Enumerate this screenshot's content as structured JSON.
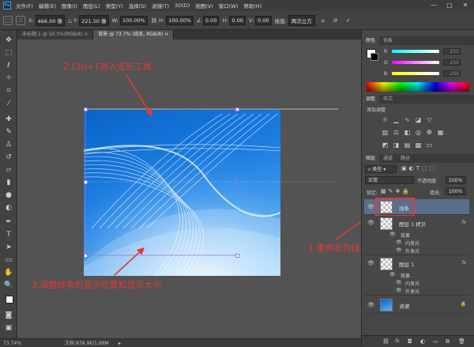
{
  "menubar": {
    "logo": "Ps",
    "items": [
      "文件(F)",
      "编辑(E)",
      "图像(I)",
      "图层(L)",
      "类型(Y)",
      "选择(S)",
      "滤镜(T)",
      "3D(D)",
      "视图(V)",
      "窗口(W)",
      "帮助(H)"
    ],
    "window_buttons": [
      "—",
      "□",
      "✕"
    ]
  },
  "options": {
    "x_label": "X:",
    "x_value": "466.00 像",
    "y_label": "Y:",
    "y_value": "221.50 像",
    "w_label": "W:",
    "w_value": "100.00%",
    "h_label": "H:",
    "h_value": "100.00%",
    "angle_value": "0.00",
    "hskew_label": "H:",
    "hskew_value": "0.00",
    "vskew_label": "V:",
    "vskew_value": "0.00",
    "interp_label": "插值:",
    "interp_value": "两次立方"
  },
  "tabs": [
    {
      "label": "未标题-1 @ 50.5%(RGB/8)",
      "close": "×"
    },
    {
      "label": "背景 @ 73.7% (线条, RGB/8)",
      "close": "×"
    }
  ],
  "status": {
    "zoom": "73.74%",
    "doc": "文档:878.9K/1.88M"
  },
  "annotations": {
    "a1": "2.Ctrl+T进入变形工具",
    "a2": "1.重命名为线条",
    "a3": "3.调整线条的显示位置和显示大小"
  },
  "color_panel": {
    "tab_color": "颜色",
    "tab_swatch": "色板",
    "r_label": "R",
    "r_value": "255",
    "g_label": "G",
    "g_value": "255",
    "b_label": "B",
    "b_value": "255"
  },
  "adjust_panel": {
    "tab_adjust": "调整",
    "tab_style": "样式",
    "title": "添加调整"
  },
  "layers_panel": {
    "tab_layers": "图层",
    "tab_channels": "通道",
    "tab_paths": "路径",
    "kind_label": "类型",
    "blend_mode": "正常",
    "opacity_label": "不透明度:",
    "opacity_value": "100%",
    "lock_label": "锁定:",
    "fill_label": "填充:",
    "fill_value": "100%",
    "layers": [
      {
        "name": "线条"
      },
      {
        "name": "图层 1 拷贝",
        "fx": "fx",
        "effects_label": "效果",
        "effects": [
          "内发光",
          "外发光"
        ]
      },
      {
        "name": "图层 1",
        "fx": "fx",
        "effects_label": "效果",
        "effects": [
          "内发光",
          "外发光"
        ]
      },
      {
        "name": "背景",
        "lock": "🔒"
      }
    ]
  }
}
